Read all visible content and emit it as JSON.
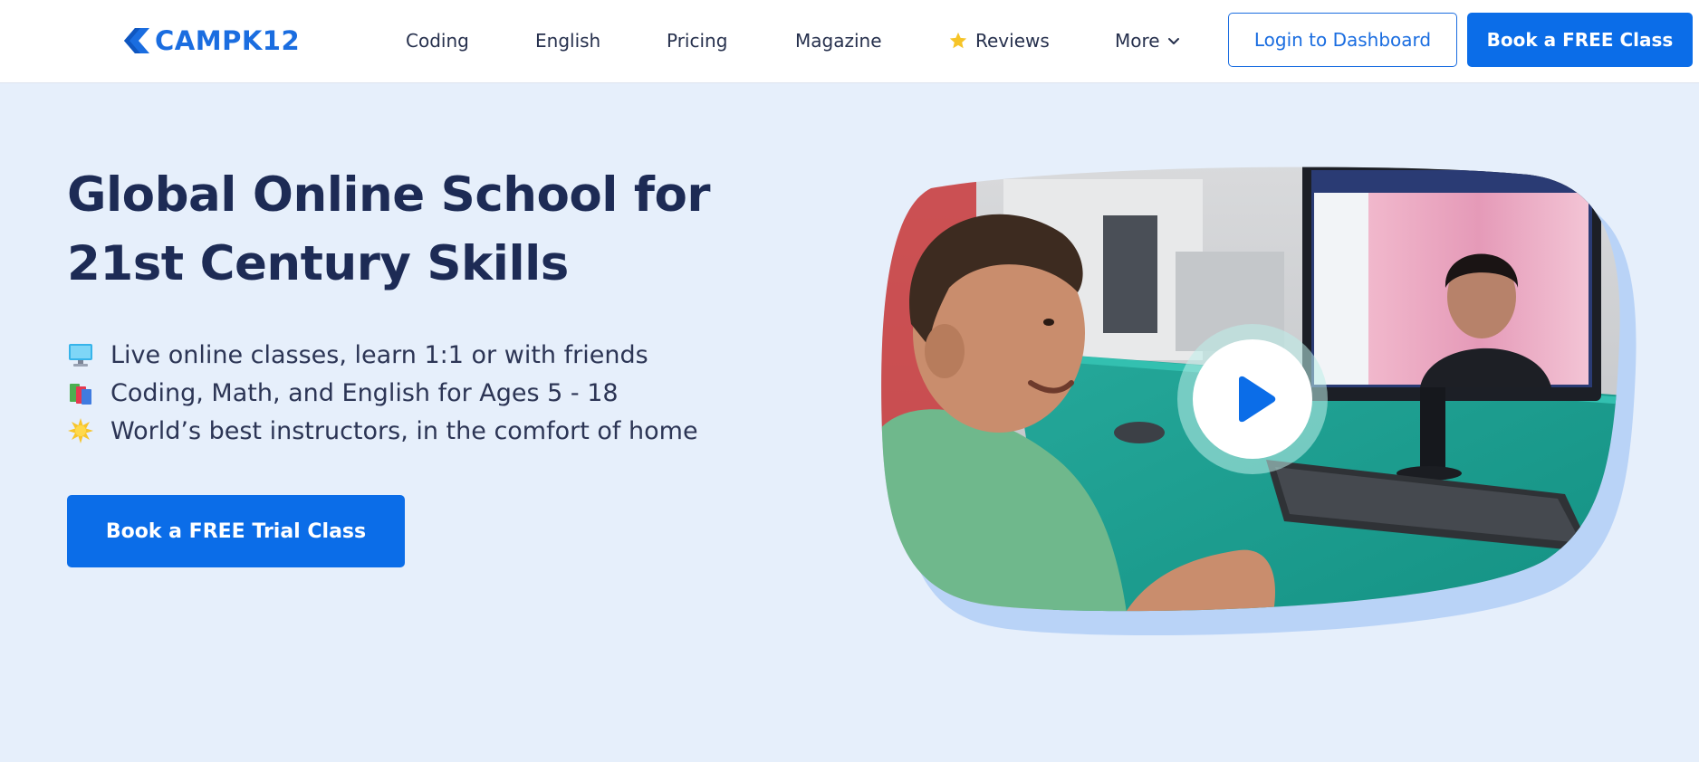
{
  "header": {
    "logo_text": "CAMPK12",
    "nav": [
      {
        "label": "Coding"
      },
      {
        "label": "English"
      },
      {
        "label": "Pricing"
      },
      {
        "label": "Magazine"
      },
      {
        "label": "Reviews",
        "icon": "star-icon"
      },
      {
        "label": "More",
        "icon": "chevron-down-icon"
      }
    ],
    "login_label": "Login to Dashboard",
    "book_label": "Book a FREE Class"
  },
  "hero": {
    "title_line1": "Global Online School for",
    "title_line2": "21st Century Skills",
    "features": [
      {
        "icon": "computer-icon",
        "text": "Live online classes, learn 1:1 or with friends"
      },
      {
        "icon": "books-icon",
        "text": "Coding, Math, and English for Ages 5 - 18"
      },
      {
        "icon": "sparkle-star-icon",
        "text": "World’s best instructors, in the comfort of home"
      }
    ],
    "cta_label": "Book a FREE Trial Class"
  },
  "video": {
    "play_icon": "play-icon"
  },
  "colors": {
    "brand_blue": "#0b6de8",
    "page_bg": "#e6effb",
    "heading": "#1d2b55"
  }
}
